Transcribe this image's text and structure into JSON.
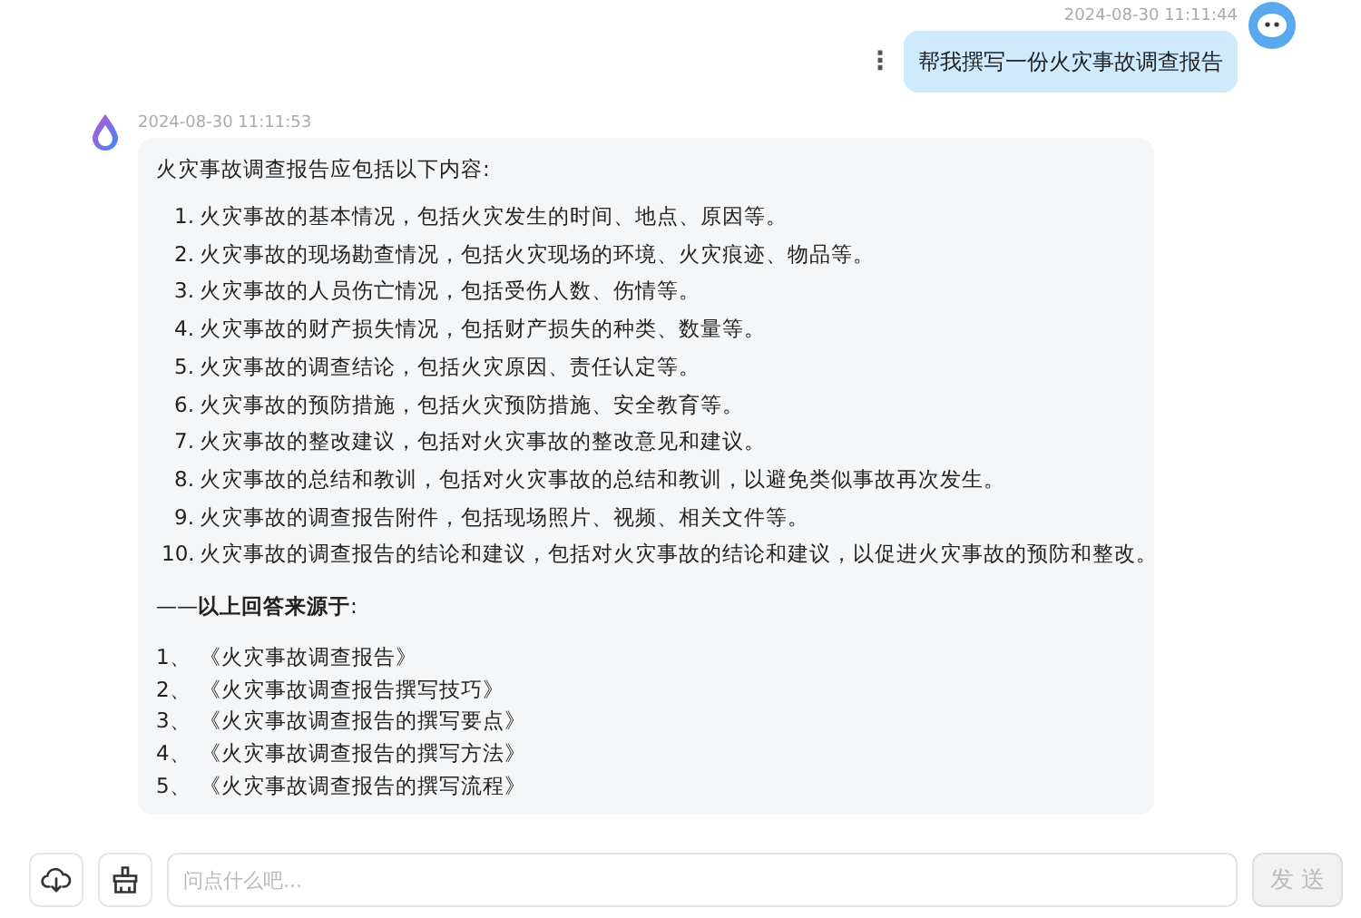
{
  "user_message": {
    "time": "2024-08-30 11:11:44",
    "text": "帮我撰写一份火灾事故调查报告",
    "menu_icon": "⋮"
  },
  "bot_message": {
    "time": "2024-08-30 11:11:53",
    "intro": "火灾事故调查报告应包括以下内容:",
    "items": [
      {
        "number": "1.",
        "text": "火灾事故的基本情况，包括火灾发生的时间、地点、原因等。"
      },
      {
        "number": "2.",
        "text": "火灾事故的现场勘查情况，包括火灾现场的环境、火灾痕迹、物品等。"
      },
      {
        "number": "3.",
        "text": "火灾事故的人员伤亡情况，包括受伤人数、伤情等。"
      },
      {
        "number": "4.",
        "text": "火灾事故的财产损失情况，包括财产损失的种类、数量等。"
      },
      {
        "number": "5.",
        "text": "火灾事故的调查结论，包括火灾原因、责任认定等。"
      },
      {
        "number": "6.",
        "text": "火灾事故的预防措施，包括火灾预防措施、安全教育等。"
      },
      {
        "number": "7.",
        "text": "火灾事故的整改建议，包括对火灾事故的整改意见和建议。"
      },
      {
        "number": "8.",
        "text": "火灾事故的总结和教训，包括对火灾事故的总结和教训，以避免类似事故再次发生。"
      },
      {
        "number": "9.",
        "text": "火灾事故的调查报告附件，包括现场照片、视频、相关文件等。"
      },
      {
        "number": "10.",
        "text": "火灾事故的调查报告的结论和建议，包括对火灾事故的结论和建议，以促进火灾事故的预防和整改。"
      }
    ],
    "sources_heading": "——**以上回答来源于**:",
    "sources": [
      {
        "number": "1、",
        "title": "《火灾事故调查报告》"
      },
      {
        "number": "2、",
        "title": "《火灾事故调查报告撰写技巧》"
      },
      {
        "number": "3、",
        "title": "《火灾事故调查报告的撰写要点》"
      },
      {
        "number": "4、",
        "title": "《火灾事故调查报告的撰写方法》"
      },
      {
        "number": "5、",
        "title": "《火灾事故调查报告的撰写流程》"
      }
    ]
  },
  "input": {
    "placeholder": "问点什么吧...",
    "send_label": "发 送",
    "send_disabled": true
  }
}
